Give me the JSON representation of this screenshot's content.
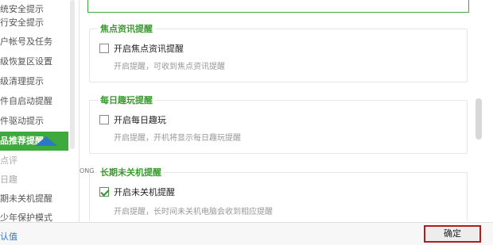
{
  "sidebar": {
    "items": [
      {
        "label": "统安全提示"
      },
      {
        "label": "行安全提示"
      },
      {
        "label": "户帐号及任务"
      },
      {
        "label": "级恢复区设置"
      },
      {
        "label": "级清理提示"
      },
      {
        "label": "件自启动提醒"
      },
      {
        "label": "件驱动提示"
      },
      {
        "label": "品推荐提醒"
      },
      {
        "label": "点评"
      },
      {
        "label": "日趣"
      },
      {
        "label": "期未关机提醒"
      },
      {
        "label": "少年保护模式"
      }
    ],
    "active_index": 7
  },
  "sections": {
    "focus_news": {
      "title": "焦点资讯提醒",
      "checkbox_label": "开启焦点资讯提醒",
      "checked": false,
      "description": "开启提醒，可收到焦点资讯提醒"
    },
    "daily_fun": {
      "title": "每日趣玩提醒",
      "checkbox_label": "开启每日趣玩",
      "checked": false,
      "description": "开启提醒，开机将显示每日趣玩提醒"
    },
    "long_on": {
      "title": "长期未关机提醒",
      "title_prefix": "ONG",
      "checkbox_label": "开启未关机提醒",
      "checked": true,
      "description": "开启提醒，长时间未关机电脑会收到相应提醒"
    }
  },
  "footer": {
    "restore_label": "认值",
    "ok_label": "确定"
  },
  "colors": {
    "accent_green": "#3ea93c",
    "link_blue": "#2b78c5",
    "highlight_red": "#b01d1d"
  }
}
